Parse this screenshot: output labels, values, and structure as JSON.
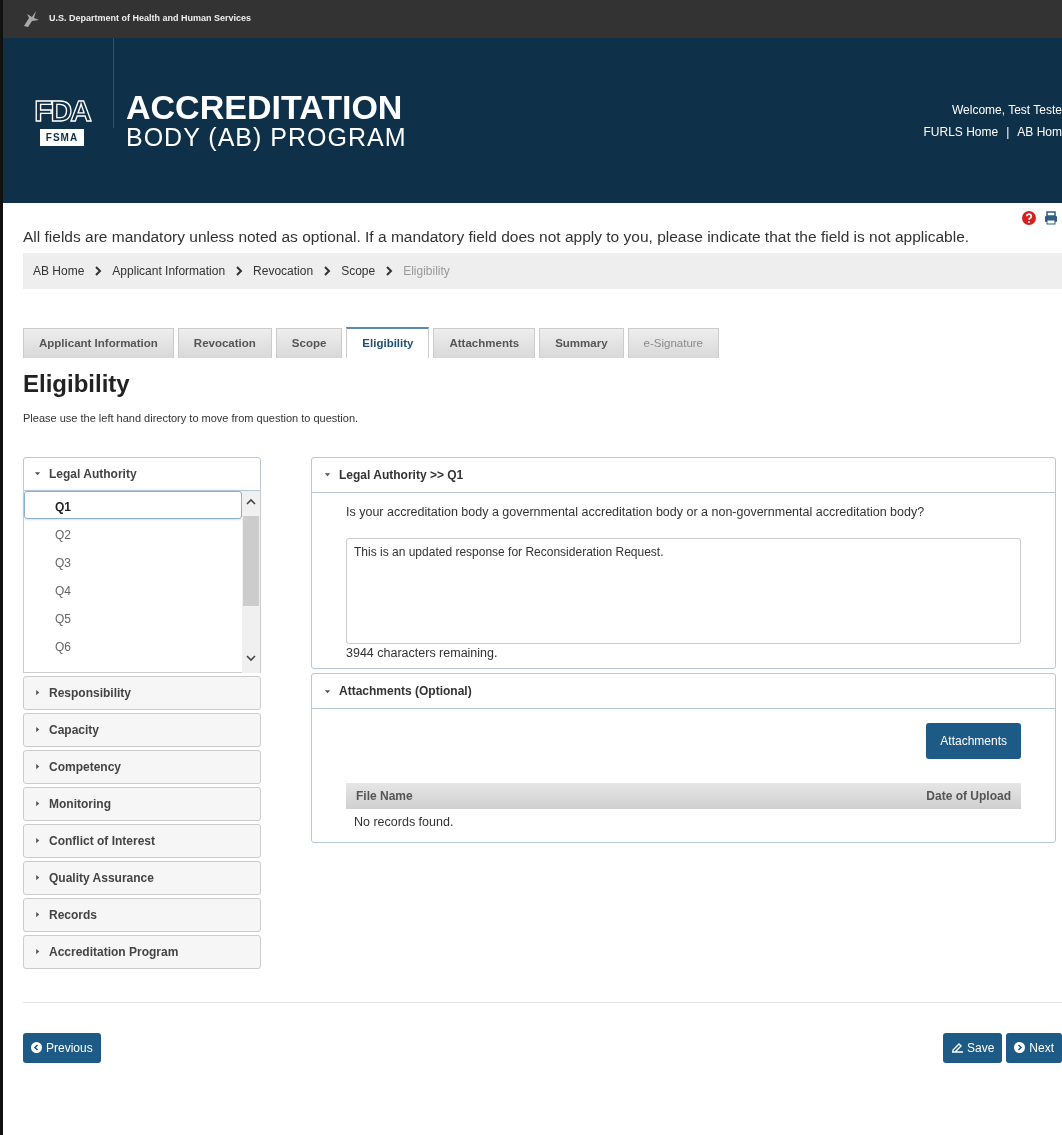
{
  "top_bar": {
    "agency": "U.S. Department of Health and Human Services"
  },
  "header": {
    "logo_text": "FDA",
    "logo_badge": "FSMA",
    "title_line1": "ACCREDITATION",
    "title_line2": "BODY (AB) PROGRAM",
    "welcome": "Welcome, Test Teste",
    "links": [
      "FURLS Home",
      "AB Hom"
    ],
    "separator": "|"
  },
  "notice": "All fields are mandatory unless noted as optional. If a mandatory field does not apply to you, please indicate that the field is not applicable.",
  "breadcrumb": [
    {
      "label": "AB Home",
      "current": false
    },
    {
      "label": "Applicant Information",
      "current": false
    },
    {
      "label": "Revocation",
      "current": false
    },
    {
      "label": "Scope",
      "current": false
    },
    {
      "label": "Eligibility",
      "current": true
    }
  ],
  "tabs": [
    {
      "label": "Applicant Information",
      "selected": false,
      "disabled": false
    },
    {
      "label": "Revocation",
      "selected": false,
      "disabled": false
    },
    {
      "label": "Scope",
      "selected": false,
      "disabled": false
    },
    {
      "label": "Eligibility",
      "selected": true,
      "disabled": false
    },
    {
      "label": "Attachments",
      "selected": false,
      "disabled": false
    },
    {
      "label": "Summary",
      "selected": false,
      "disabled": false
    },
    {
      "label": "e-Signature",
      "selected": false,
      "disabled": true
    }
  ],
  "heading": "Eligibility",
  "instruction": "Please use the left hand directory to move from question to question.",
  "directory": [
    {
      "label": "Legal Authority",
      "expanded": true,
      "questions": [
        {
          "label": "Q1",
          "selected": true
        },
        {
          "label": "Q2",
          "selected": false
        },
        {
          "label": "Q3",
          "selected": false
        },
        {
          "label": "Q4",
          "selected": false
        },
        {
          "label": "Q5",
          "selected": false
        },
        {
          "label": "Q6",
          "selected": false
        }
      ]
    },
    {
      "label": "Responsibility",
      "expanded": false
    },
    {
      "label": "Capacity",
      "expanded": false
    },
    {
      "label": "Competency",
      "expanded": false
    },
    {
      "label": "Monitoring",
      "expanded": false
    },
    {
      "label": "Conflict of Interest",
      "expanded": false
    },
    {
      "label": "Quality Assurance",
      "expanded": false
    },
    {
      "label": "Records",
      "expanded": false
    },
    {
      "label": "Accreditation Program",
      "expanded": false
    }
  ],
  "question_panel": {
    "title": "Legal Authority >> Q1",
    "expanded": true,
    "question": "Is your accreditation body a governmental accreditation body or a non-governmental accreditation body?",
    "answer": "This is an updated response for Reconsideration Request.",
    "remaining": "3944 characters remaining."
  },
  "attachments_panel": {
    "title": "Attachments (Optional)",
    "expanded": true,
    "button": "Attachments",
    "columns": [
      "File Name",
      "Date of Upload"
    ],
    "empty_message": "No records found."
  },
  "footer_buttons": {
    "previous": "Previous",
    "save": "Save",
    "next": "Next"
  }
}
